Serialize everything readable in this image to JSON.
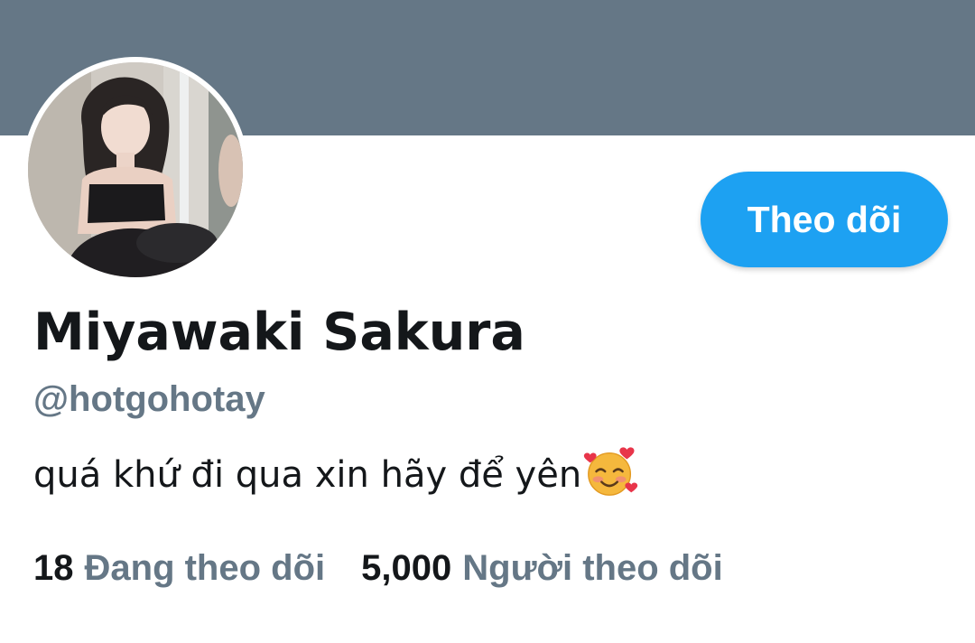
{
  "profile": {
    "display_name": "Miyawaki Sakura",
    "handle": "@hotgohotay",
    "bio": "quá khứ đi qua xin hãy để yên",
    "bio_emoji": "smiling-face-with-hearts-icon",
    "follow_button_label": "Theo dõi"
  },
  "stats": {
    "following_count": "18",
    "following_label": "Đang theo dõi",
    "followers_count": "5,000",
    "followers_label": "Người theo dõi"
  },
  "colors": {
    "banner": "#657786",
    "accent": "#1da1f2",
    "text_primary": "#14171a",
    "text_secondary": "#657786"
  }
}
